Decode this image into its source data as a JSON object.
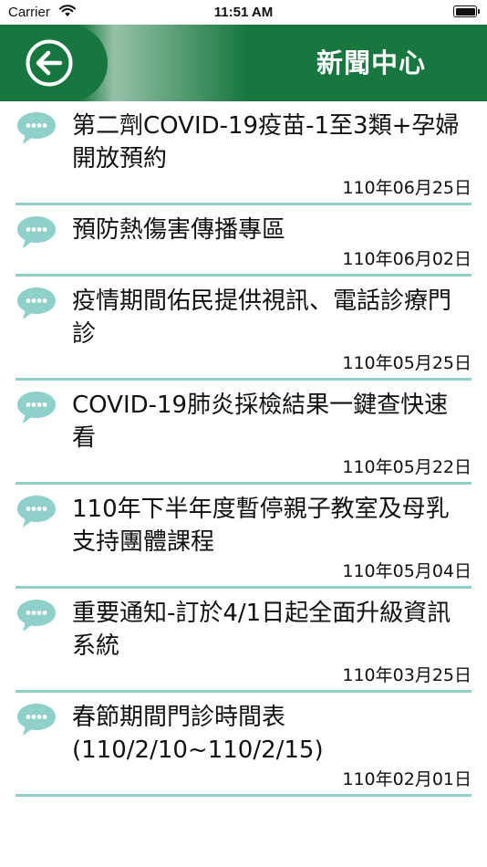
{
  "status_bar": {
    "carrier": "Carrier",
    "time": "11:51 AM"
  },
  "nav": {
    "title": "新聞中心",
    "back_icon": "arrow-left-circle-icon"
  },
  "colors": {
    "nav_green": "#17773f",
    "divider": "#8fd0cb",
    "bubble": "#8fd0cb"
  },
  "news": [
    {
      "title": "第二劑COVID-19疫苗-1至3類+孕婦開放預約",
      "date": "110年06月25日"
    },
    {
      "title": "預防熱傷害傳播專區",
      "date": "110年06月02日"
    },
    {
      "title": "疫情期間佑民提供視訊、電話診療門診",
      "date": "110年05月25日"
    },
    {
      "title": "COVID-19肺炎採檢結果一鍵查快速看",
      "date": "110年05月22日"
    },
    {
      "title": "110年下半年度暫停親子教室及母乳支持團體課程",
      "date": "110年05月04日"
    },
    {
      "title": "重要通知-訂於4/1日起全面升級資訊系統",
      "date": "110年03月25日"
    },
    {
      "title": "春節期間門診時間表(110/2/10~110/2/15)",
      "date": "110年02月01日"
    }
  ]
}
